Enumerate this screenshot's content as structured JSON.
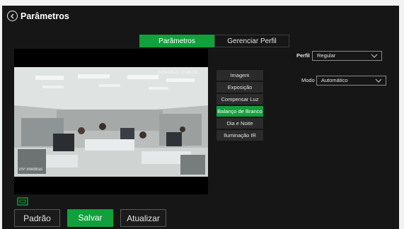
{
  "page": {
    "title": "Parâmetros",
    "back_icon": "chevron-left-circle-icon"
  },
  "tabs": [
    {
      "label": "Parâmetros",
      "active": true
    },
    {
      "label": "Gerenciar Perfil",
      "active": false
    }
  ],
  "video": {
    "overlay_timestamp": "2019-06-21 10:39:23",
    "overlay_channel": "VIP Intelbras",
    "fit_icon": "fit-screen-icon"
  },
  "menu": {
    "items": [
      {
        "label": "Imagem",
        "active": false
      },
      {
        "label": "Exposição",
        "active": false
      },
      {
        "label": "Compensar Luz",
        "active": false
      },
      {
        "label": "Balanço de Branco",
        "active": true
      },
      {
        "label": "Dia e Noite",
        "active": false
      },
      {
        "label": "Iluminação IR",
        "active": false
      }
    ]
  },
  "profile": {
    "label": "Perfil",
    "value": "Regular"
  },
  "mode": {
    "label": "Modo",
    "value": "Automático"
  },
  "buttons": {
    "default_label": "Padrão",
    "save_label": "Salvar",
    "refresh_label": "Atualizar"
  },
  "colors": {
    "accent": "#12a03c",
    "panel": "#161616"
  }
}
